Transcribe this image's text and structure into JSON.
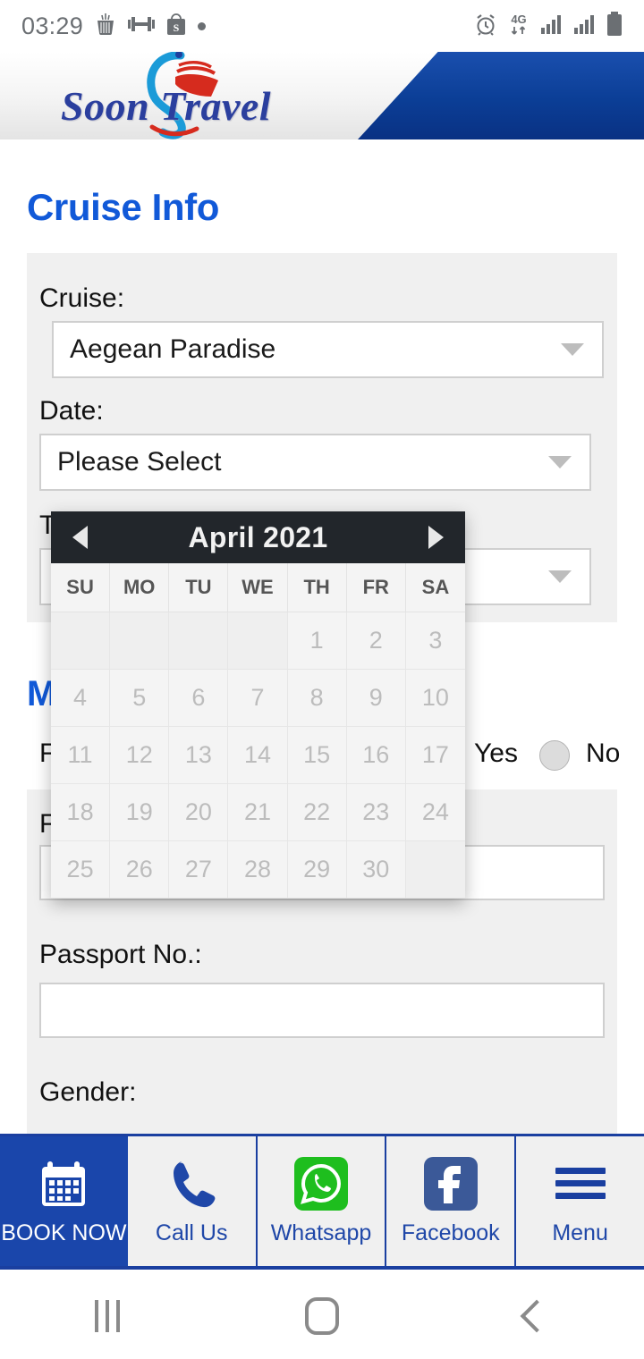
{
  "status_bar": {
    "time": "03:29",
    "left_icons": [
      "food-delivery-icon",
      "dumbbell-icon",
      "shopee-bag-icon",
      "dot-icon"
    ],
    "right_icons": [
      "alarm-icon",
      "4g-data-icon",
      "signal-1-icon",
      "signal-2-icon",
      "battery-icon"
    ],
    "network_label": "4G"
  },
  "header": {
    "logo_text_1": "Soon",
    "logo_text_2": "Travel",
    "logo_full": "Soon Travel"
  },
  "page": {
    "title": "Cruise Info"
  },
  "cruise_form": {
    "cruise_label": "Cruise:",
    "cruise_value": "Aegean Paradise",
    "date_label": "Date:",
    "date_value": "Please Select",
    "third_label": "T",
    "third_value": ""
  },
  "main_passenger": {
    "title": "M",
    "first_label": "Fi",
    "radio_yes": "Yes",
    "radio_no": "No",
    "fullname_label": "F",
    "fullname_value": "",
    "passport_label": "Passport No.:",
    "passport_value": "",
    "gender_label": "Gender:"
  },
  "calendar": {
    "month_title": "April 2021",
    "prev_label": "◄",
    "next_label": "►",
    "day_headers": [
      "SU",
      "MO",
      "TU",
      "WE",
      "TH",
      "FR",
      "SA"
    ],
    "leading_blanks": 4,
    "days": [
      1,
      2,
      3,
      4,
      5,
      6,
      7,
      8,
      9,
      10,
      11,
      12,
      13,
      14,
      15,
      16,
      17,
      18,
      19,
      20,
      21,
      22,
      23,
      24,
      25,
      26,
      27,
      28,
      29,
      30
    ],
    "trailing_blanks": 1,
    "all_disabled": true
  },
  "bottom_bar": {
    "items": [
      {
        "label": "BOOK NOW",
        "icon": "calendar-icon",
        "primary": true
      },
      {
        "label": "Call Us",
        "icon": "phone-icon",
        "primary": false
      },
      {
        "label": "Whatsapp",
        "icon": "whatsapp-icon",
        "primary": false
      },
      {
        "label": "Facebook",
        "icon": "facebook-icon",
        "primary": false
      },
      {
        "label": "Menu",
        "icon": "hamburger-icon",
        "primary": false
      }
    ]
  },
  "android_nav": {
    "recents": "recents-icon",
    "home": "home-icon",
    "back": "back-icon"
  },
  "colors": {
    "brand_blue": "#1159d8",
    "header_blue": "#0b3e96",
    "bar_blue": "#1a46ab",
    "panel_gray": "#f0f0f0",
    "calendar_header": "#22262b",
    "whatsapp_green": "#1ebe1e",
    "facebook_blue": "#3b5998"
  }
}
